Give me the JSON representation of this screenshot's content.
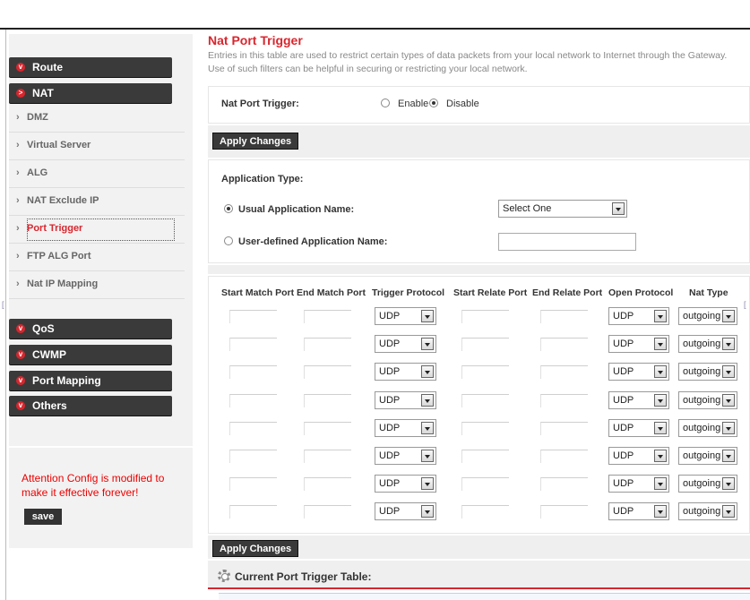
{
  "sidebar": {
    "groups_top": [
      {
        "label": "Route",
        "bullet": "v"
      },
      {
        "label": "NAT",
        "bullet": ">"
      }
    ],
    "nat_items": [
      {
        "label": "DMZ"
      },
      {
        "label": "Virtual Server"
      },
      {
        "label": "ALG"
      },
      {
        "label": "NAT Exclude IP"
      },
      {
        "label": "Port Trigger",
        "active": true
      },
      {
        "label": "FTP ALG Port"
      },
      {
        "label": "Nat IP Mapping"
      }
    ],
    "groups_bottom": [
      {
        "label": "QoS",
        "bullet": "v"
      },
      {
        "label": "CWMP",
        "bullet": "v"
      },
      {
        "label": "Port Mapping",
        "bullet": "v"
      },
      {
        "label": "Others",
        "bullet": "v"
      }
    ],
    "attention": "Attention Config is modified to make it effective forever!",
    "save_label": "save"
  },
  "page": {
    "title": "Nat Port Trigger",
    "description": "Entries in this table are used to restrict certain types of data packets from your local network to Internet through the Gateway. Use of such filters can be helpful in securing or restricting your local network."
  },
  "trigger": {
    "label": "Nat Port Trigger:",
    "enable": "Enable",
    "disable": "Disable",
    "selected": "Disable"
  },
  "apply_label": "Apply Changes",
  "app": {
    "type_label": "Application Type:",
    "usual_label": "Usual Application Name:",
    "usual_value": "Select One",
    "user_label": "User-defined Application Name:",
    "user_value": "",
    "selected": "usual"
  },
  "table": {
    "headers": [
      "Start Match Port",
      "End Match Port",
      "Trigger Protocol",
      "Start Relate Port",
      "End Relate Port",
      "Open Protocol",
      "Nat Type"
    ],
    "rows": [
      {
        "trigger_protocol": "UDP",
        "open_protocol": "UDP",
        "nat_type": "outgoing"
      },
      {
        "trigger_protocol": "UDP",
        "open_protocol": "UDP",
        "nat_type": "outgoing"
      },
      {
        "trigger_protocol": "UDP",
        "open_protocol": "UDP",
        "nat_type": "outgoing"
      },
      {
        "trigger_protocol": "UDP",
        "open_protocol": "UDP",
        "nat_type": "outgoing"
      },
      {
        "trigger_protocol": "UDP",
        "open_protocol": "UDP",
        "nat_type": "outgoing"
      },
      {
        "trigger_protocol": "UDP",
        "open_protocol": "UDP",
        "nat_type": "outgoing"
      },
      {
        "trigger_protocol": "UDP",
        "open_protocol": "UDP",
        "nat_type": "outgoing"
      },
      {
        "trigger_protocol": "UDP",
        "open_protocol": "UDP",
        "nat_type": "outgoing"
      }
    ]
  },
  "current_table_title": "Current Port Trigger Table:",
  "colors": {
    "accent": "#d8262e",
    "nav_dark": "#3a3a3a",
    "panel_grey": "#efefef"
  },
  "icons": {
    "expand": "chevron-bullet-icon",
    "sub": "arrow-right-icon",
    "section": "gear-icon"
  }
}
